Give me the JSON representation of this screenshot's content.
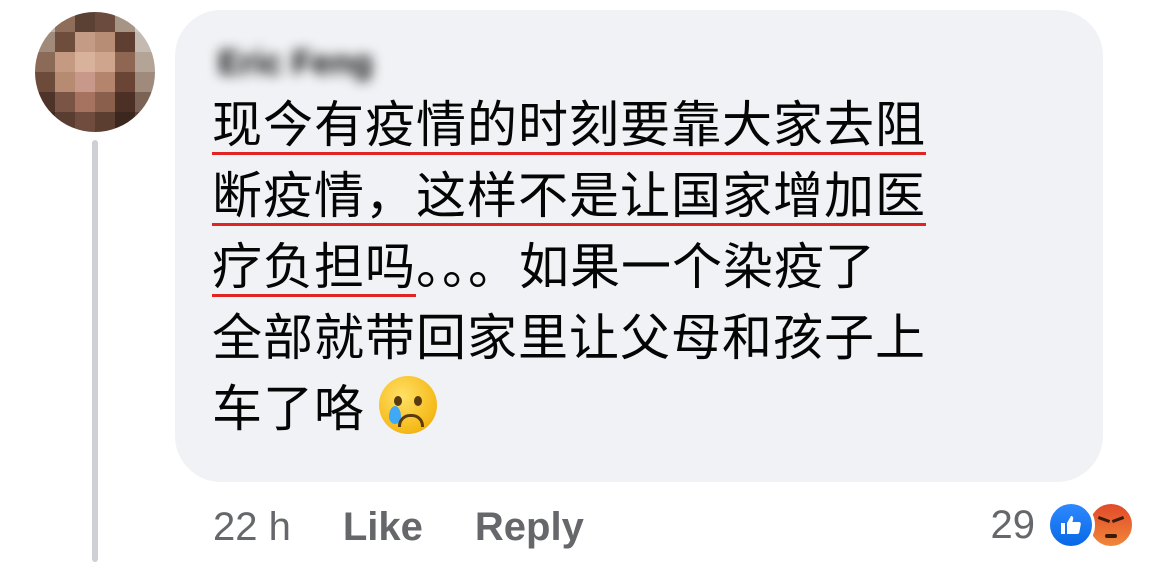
{
  "comment": {
    "author": "Eric Feng",
    "lines": [
      "现今有疫情的时刻要靠大家去阻",
      "断疫情，这样不是让国家增加医",
      "疗负担吗。。。如果一个染疫了",
      "全部就带回家里让父母和孩子上",
      "车了咯"
    ],
    "emoji": "crying-face-icon"
  },
  "meta": {
    "time": "22 h",
    "like_label": "Like",
    "reply_label": "Reply"
  },
  "reactions": {
    "count": "29",
    "types": [
      "like-icon",
      "angry-icon"
    ]
  },
  "colors": {
    "bubble": "#f0f2f5",
    "underline": "#e02424",
    "like": "#1877f2",
    "secondary_text": "#65676b"
  }
}
